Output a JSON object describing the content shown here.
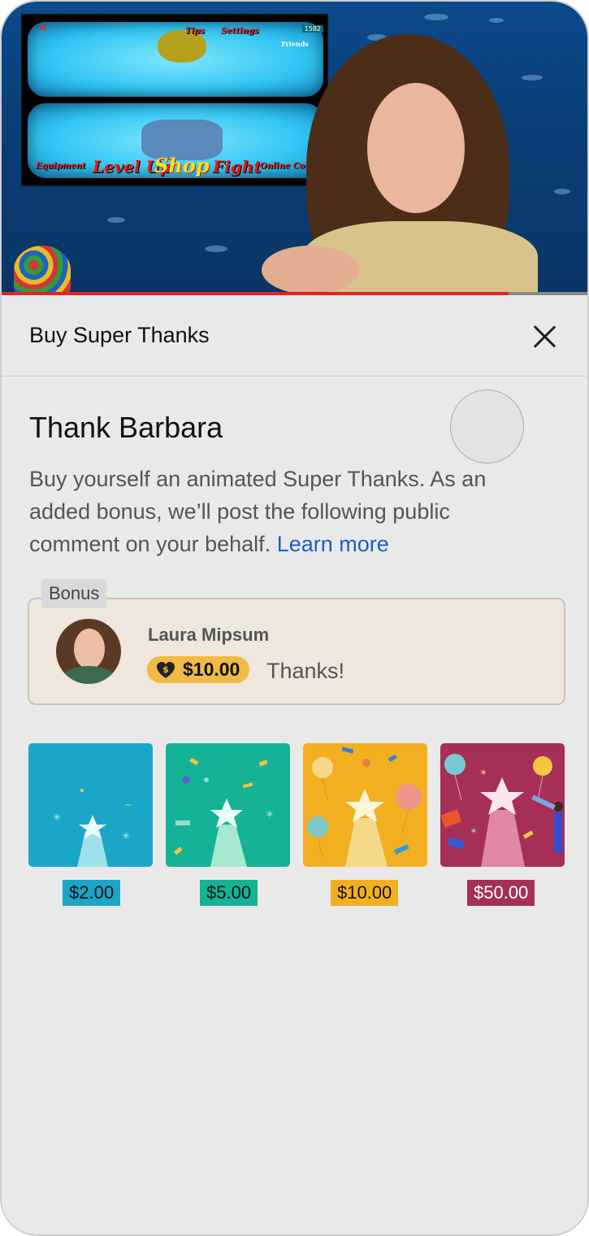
{
  "video": {
    "game_menu": {
      "top_labels": [
        "Tips",
        "Settings"
      ],
      "score": "1582",
      "friends_label": "Friends",
      "bottom_labels": [
        "Equipment",
        "Level Up",
        "Shop",
        "Fight",
        "Online Co-Op"
      ]
    },
    "progress_fraction": 0.86,
    "progress_color": "#e52222"
  },
  "sheet": {
    "title": "Buy Super Thanks",
    "heading": "Thank Barbara",
    "description": "Buy yourself an animated Super Thanks. As an added bonus, we’ll post the following public comment on your behalf.",
    "learn_more": "Learn more",
    "bonus": {
      "tag": "Bonus",
      "user_name": "Laura Mipsum",
      "amount": "$10.00",
      "comment": "Thanks!",
      "pill_color": "#f0bb45",
      "card_color": "#efe7db"
    },
    "options": [
      {
        "price": "$2.00",
        "bg": "#1aa6c8",
        "tag_color": "#1aa6c8"
      },
      {
        "price": "$5.00",
        "bg": "#14b395",
        "tag_color": "#14b395"
      },
      {
        "price": "$10.00",
        "bg": "#f2b021",
        "tag_color": "#f2b021"
      },
      {
        "price": "$50.00",
        "bg": "#a62f57",
        "tag_color": "#a62f57"
      }
    ]
  }
}
